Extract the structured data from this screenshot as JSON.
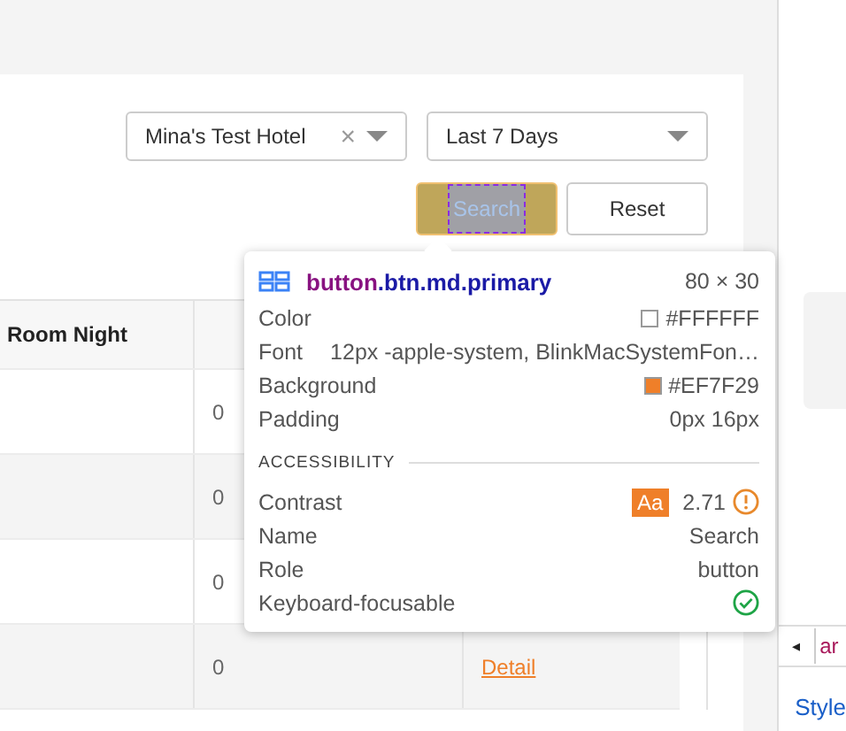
{
  "filters": {
    "hotel": {
      "value": "Mina's Test Hotel",
      "clear": "×"
    },
    "period": {
      "value": "Last 7 Days"
    }
  },
  "buttons": [
    {
      "label": "Search",
      "kind": "primary",
      "inspected": true
    },
    {
      "label": "Reset",
      "kind": "default",
      "inspected": false
    }
  ],
  "table": {
    "columns": [
      "Room Night"
    ],
    "rows": [
      {
        "column_2": "0"
      },
      {
        "column_2": "0"
      },
      {
        "column_2": "0"
      },
      {
        "column_2": "0",
        "column_3": "Detail"
      }
    ]
  },
  "inspector": {
    "tag": "button",
    "classes": ".btn.md.primary",
    "size": "80 × 30",
    "properties": [
      {
        "label": "Color",
        "value": "#FFFFFF",
        "color": "#ffffff"
      },
      {
        "label": "Font",
        "value": "12px -apple-system, BlinkMacSystemFon…"
      },
      {
        "label": "Background",
        "value": "#EF7F29",
        "color": "#ef7f29"
      },
      {
        "label": "Padding",
        "value": "0px 16px"
      }
    ],
    "section": "ACCESSIBILITY",
    "accessibility": [
      {
        "label": "Contrast",
        "kind": "contrast",
        "badge": "Aa",
        "value": "2.71",
        "warning": true
      },
      {
        "label": "Name",
        "kind": "text",
        "value": "Search"
      },
      {
        "label": "Role",
        "kind": "text",
        "value": "button"
      },
      {
        "label": "Keyboard-focusable",
        "kind": "check",
        "value": true
      }
    ]
  },
  "devtools": {
    "arrow": "◂",
    "tab": "ar",
    "styles_tab": "Style"
  }
}
